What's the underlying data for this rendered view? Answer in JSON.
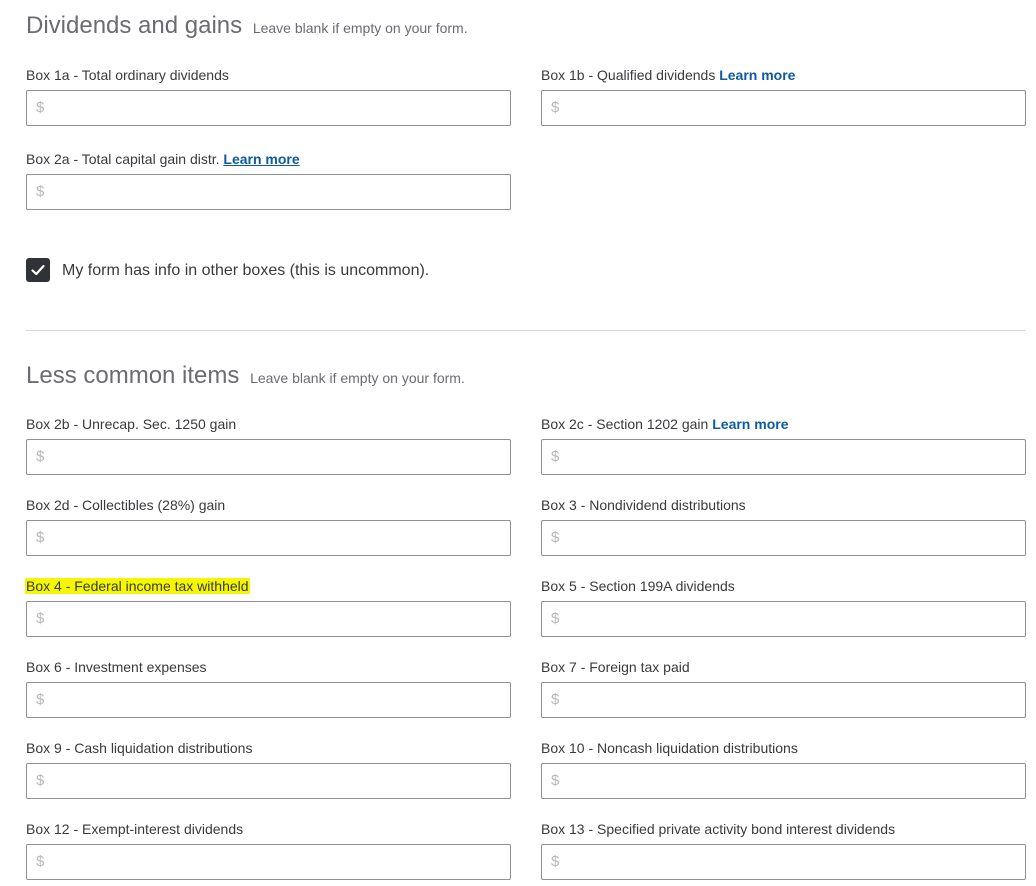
{
  "section1": {
    "title": "Dividends and gains",
    "subtitle": "Leave blank if empty on your form.",
    "fields": [
      {
        "label": "Box 1a - Total ordinary dividends",
        "placeholder": "$"
      },
      {
        "label": "Box 1b - Qualified dividends",
        "learn_more": "Learn more",
        "placeholder": "$"
      },
      {
        "label": "Box 2a - Total capital gain distr.",
        "learn_more": "Learn more",
        "placeholder": "$"
      }
    ]
  },
  "checkbox": {
    "label": "My form has info in other boxes (this is uncommon).",
    "checked": true
  },
  "section2": {
    "title": "Less common items",
    "subtitle": "Leave blank if empty on your form.",
    "fields": [
      {
        "label": "Box 2b - Unrecap. Sec. 1250 gain",
        "placeholder": "$"
      },
      {
        "label": "Box 2c - Section 1202 gain",
        "learn_more": "Learn more",
        "placeholder": "$"
      },
      {
        "label": "Box 2d - Collectibles (28%) gain",
        "placeholder": "$"
      },
      {
        "label": "Box 3 - Nondividend distributions",
        "placeholder": "$"
      },
      {
        "label": "Box 4 - Federal income tax withheld",
        "placeholder": "$",
        "highlighted": true
      },
      {
        "label": "Box 5 - Section 199A dividends",
        "placeholder": "$"
      },
      {
        "label": "Box 6 - Investment expenses",
        "placeholder": "$"
      },
      {
        "label": "Box 7 - Foreign tax paid",
        "placeholder": "$"
      },
      {
        "label": "Box 9 - Cash liquidation distributions",
        "placeholder": "$"
      },
      {
        "label": "Box 10 - Noncash liquidation distributions",
        "placeholder": "$"
      },
      {
        "label": "Box 12 - Exempt-interest dividends",
        "placeholder": "$"
      },
      {
        "label": "Box 13 - Specified private activity bond interest dividends",
        "placeholder": "$"
      }
    ]
  },
  "colors": {
    "link": "#0d5b9e",
    "highlight": "#f5f700",
    "checkbox": "#2f3237"
  }
}
